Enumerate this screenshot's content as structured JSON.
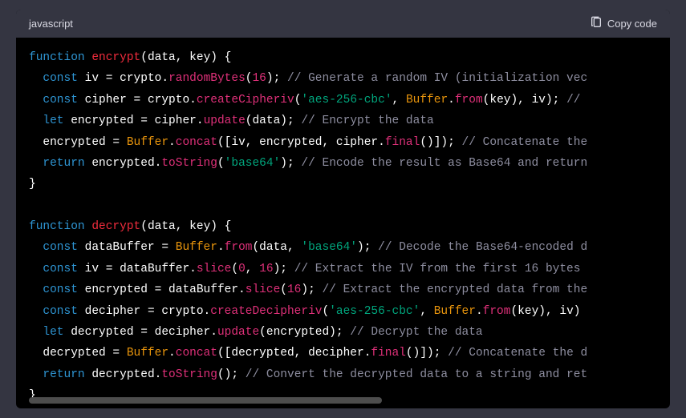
{
  "header": {
    "language": "javascript",
    "copy_label": "Copy code"
  },
  "code": {
    "l1": {
      "kw1": "function",
      "fn": "encrypt",
      "pun1": "(data, key) {"
    },
    "l2": {
      "kw": "const",
      "id": " iv ",
      "pun1": "= crypto.",
      "m": "randomBytes",
      "pun2": "(",
      "n": "16",
      "pun3": "); ",
      "cmt": "// Generate a random IV (initialization vec"
    },
    "l3": {
      "kw": "const",
      "id": " cipher ",
      "pun1": "= crypto.",
      "m": "createCipheriv",
      "pun2": "(",
      "s": "'aes-256-cbc'",
      "pun3": ", ",
      "cls": "Buffer",
      "pun4": ".",
      "m2": "from",
      "pun5": "(key), iv); ",
      "cmt": "//"
    },
    "l4": {
      "kw": "let",
      "id": " encrypted ",
      "pun1": "= cipher.",
      "m": "update",
      "pun2": "(data); ",
      "cmt": "// Encrypt the data"
    },
    "l5": {
      "id": "encrypted ",
      "pun1": "= ",
      "cls": "Buffer",
      "pun2": ".",
      "m": "concat",
      "pun3": "([iv, encrypted, cipher.",
      "m2": "final",
      "pun4": "()]); ",
      "cmt": "// Concatenate the"
    },
    "l6": {
      "kw": "return",
      "id": " encrypted.",
      "m": "toString",
      "pun1": "(",
      "s": "'base64'",
      "pun2": "); ",
      "cmt": "// Encode the result as Base64 and return"
    },
    "l7": {
      "pun": "}"
    },
    "l8": {
      "blank": ""
    },
    "l9": {
      "kw1": "function",
      "fn": "decrypt",
      "pun1": "(data, key) {"
    },
    "l10": {
      "kw": "const",
      "id": " dataBuffer ",
      "pun1": "= ",
      "cls": "Buffer",
      "pun2": ".",
      "m": "from",
      "pun3": "(data, ",
      "s": "'base64'",
      "pun4": "); ",
      "cmt": "// Decode the Base64-encoded d"
    },
    "l11": {
      "kw": "const",
      "id": " iv ",
      "pun1": "= dataBuffer.",
      "m": "slice",
      "pun2": "(",
      "n1": "0",
      "pun3": ", ",
      "n2": "16",
      "pun4": "); ",
      "cmt": "// Extract the IV from the first 16 bytes"
    },
    "l12": {
      "kw": "const",
      "id": " encrypted ",
      "pun1": "= dataBuffer.",
      "m": "slice",
      "pun2": "(",
      "n": "16",
      "pun3": "); ",
      "cmt": "// Extract the encrypted data from the"
    },
    "l13": {
      "kw": "const",
      "id": " decipher ",
      "pun1": "= crypto.",
      "m": "createDecipheriv",
      "pun2": "(",
      "s": "'aes-256-cbc'",
      "pun3": ", ",
      "cls": "Buffer",
      "pun4": ".",
      "m2": "from",
      "pun5": "(key), iv)"
    },
    "l14": {
      "kw": "let",
      "id": " decrypted ",
      "pun1": "= decipher.",
      "m": "update",
      "pun2": "(encrypted); ",
      "cmt": "// Decrypt the data"
    },
    "l15": {
      "id": "decrypted ",
      "pun1": "= ",
      "cls": "Buffer",
      "pun2": ".",
      "m": "concat",
      "pun3": "([decrypted, decipher.",
      "m2": "final",
      "pun4": "()]); ",
      "cmt": "// Concatenate the d"
    },
    "l16": {
      "kw": "return",
      "id": " decrypted.",
      "m": "toString",
      "pun1": "(); ",
      "cmt": "// Convert the decrypted data to a string and ret"
    },
    "l17": {
      "pun": "}"
    }
  }
}
